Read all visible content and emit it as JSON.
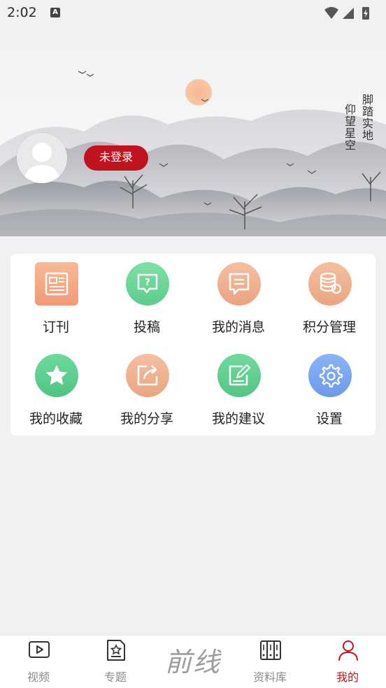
{
  "status_bar": {
    "time": "2:02",
    "notif_icon": "A"
  },
  "banner": {
    "poem_line1": "脚踏实地",
    "poem_line2": "仰望星空",
    "login_label": "未登录"
  },
  "menu": {
    "items": [
      {
        "label": "订刊",
        "icon": "newspaper-icon",
        "color": "#f6a07c"
      },
      {
        "label": "投稿",
        "icon": "question-bubble-icon",
        "color": "#6cd59a"
      },
      {
        "label": "我的消息",
        "icon": "message-icon",
        "color": "#f0b08e"
      },
      {
        "label": "积分管理",
        "icon": "coins-icon",
        "color": "#efb28e"
      },
      {
        "label": "我的收藏",
        "icon": "star-icon",
        "color": "#5fcf8e"
      },
      {
        "label": "我的分享",
        "icon": "share-icon",
        "color": "#efb08c"
      },
      {
        "label": "我的建议",
        "icon": "edit-icon",
        "color": "#63d093"
      },
      {
        "label": "设置",
        "icon": "gear-icon",
        "color": "#7aa6f3"
      }
    ]
  },
  "bottom_nav": {
    "items": [
      {
        "label": "视频",
        "icon": "video-play-icon"
      },
      {
        "label": "专题",
        "icon": "topic-star-icon"
      },
      {
        "label": "资料库",
        "icon": "books-icon"
      },
      {
        "label": "我的",
        "icon": "person-icon",
        "active": true
      }
    ],
    "logo": "前线"
  },
  "colors": {
    "accent": "#c1131f",
    "background": "#f1f1f3"
  }
}
